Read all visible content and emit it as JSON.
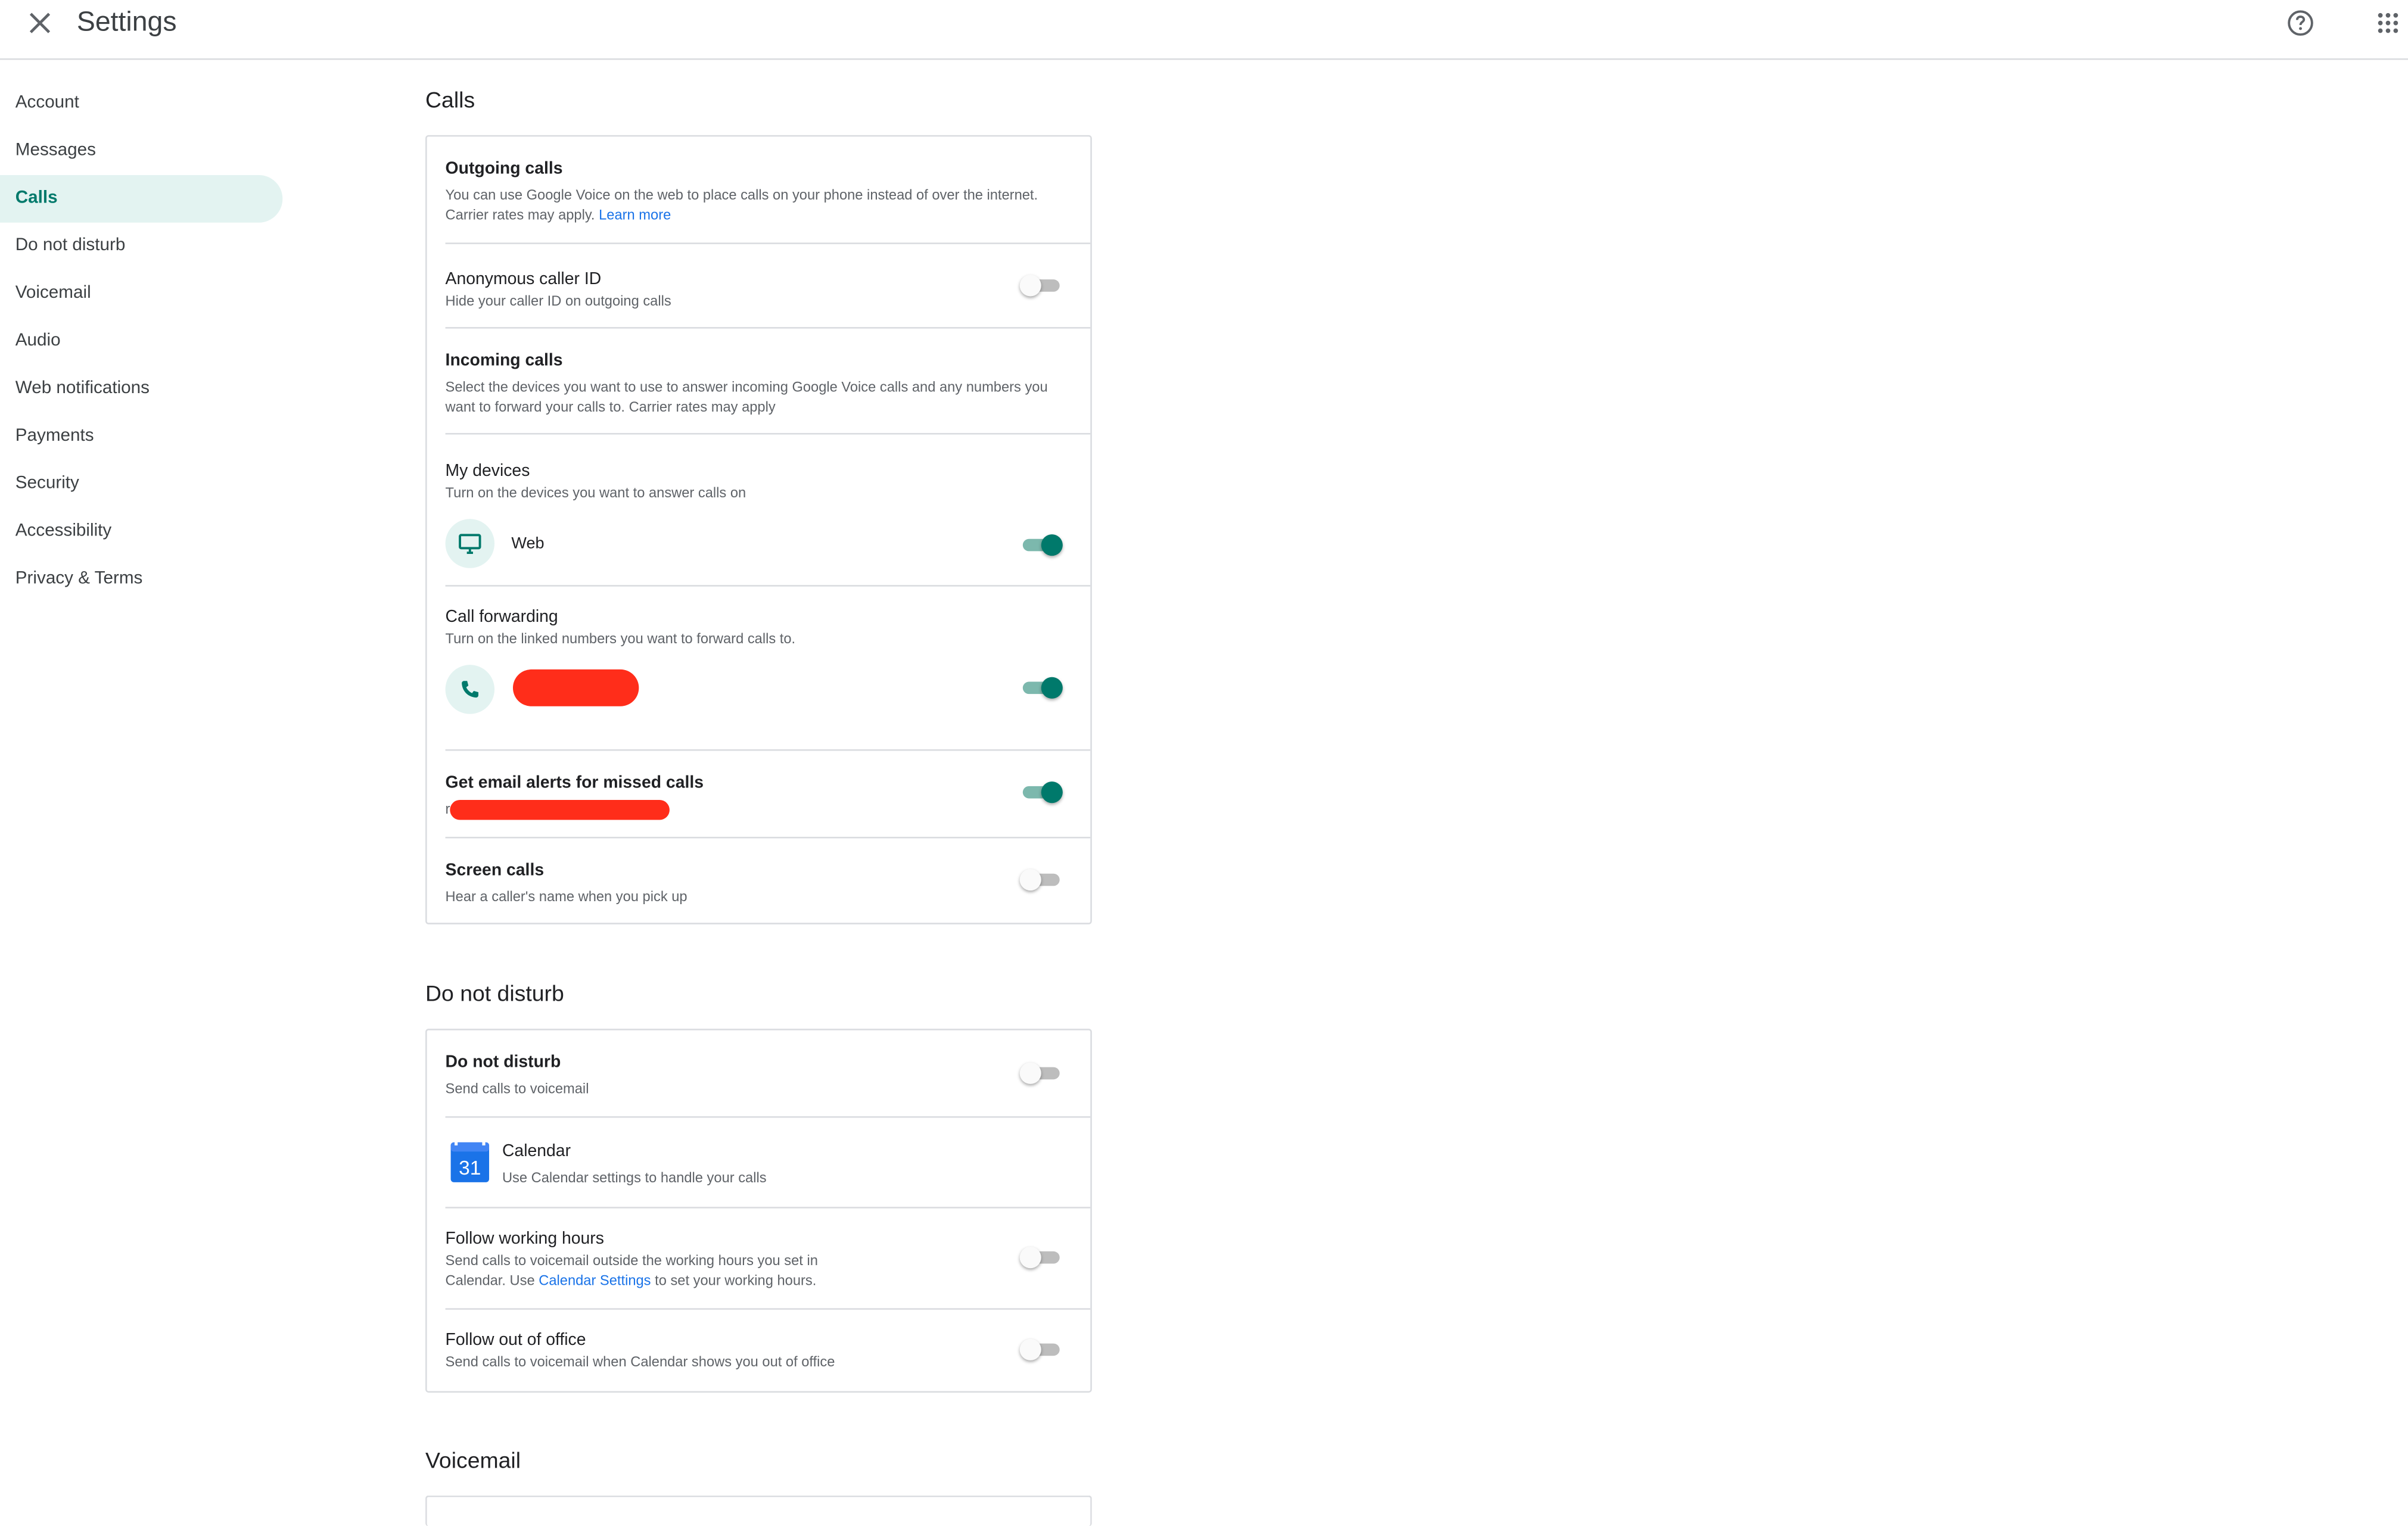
{
  "header": {
    "title": "Settings"
  },
  "sidebar": {
    "items": [
      {
        "label": "Account",
        "active": false
      },
      {
        "label": "Messages",
        "active": false
      },
      {
        "label": "Calls",
        "active": true
      },
      {
        "label": "Do not disturb",
        "active": false
      },
      {
        "label": "Voicemail",
        "active": false
      },
      {
        "label": "Audio",
        "active": false
      },
      {
        "label": "Web notifications",
        "active": false
      },
      {
        "label": "Payments",
        "active": false
      },
      {
        "label": "Security",
        "active": false
      },
      {
        "label": "Accessibility",
        "active": false
      },
      {
        "label": "Privacy & Terms",
        "active": false
      }
    ]
  },
  "calls": {
    "section_title": "Calls",
    "outgoing": {
      "title": "Outgoing calls",
      "desc": "You can use Google Voice on the web to place calls on your phone instead of over the internet. Carrier rates may apply.",
      "link": "Learn more"
    },
    "anonymous": {
      "title": "Anonymous caller ID",
      "desc": "Hide your caller ID on outgoing calls",
      "enabled": false
    },
    "incoming": {
      "title": "Incoming calls",
      "desc": "Select the devices you want to use to answer incoming Google Voice calls and any numbers you want to forward your calls to. Carrier rates may apply"
    },
    "my_devices": {
      "title": "My devices",
      "desc": "Turn on the devices you want to answer calls on",
      "device_icon": "monitor-icon",
      "device_label": "Web",
      "enabled": true
    },
    "forwarding": {
      "title": "Call forwarding",
      "desc": "Turn on the linked numbers you want to forward calls to.",
      "icon": "phone-icon",
      "enabled": true
    },
    "email_alerts": {
      "title": "Get email alerts for missed calls",
      "prefix": "r",
      "enabled": true
    },
    "screen": {
      "title": "Screen calls",
      "desc": "Hear a caller's name when you pick up",
      "enabled": false
    }
  },
  "dnd": {
    "section_title": "Do not disturb",
    "main": {
      "title": "Do not disturb",
      "desc": "Send calls to voicemail",
      "enabled": false
    },
    "calendar": {
      "title": "Calendar",
      "desc": "Use Calendar settings to handle your calls",
      "day": "31"
    },
    "working_hours": {
      "title": "Follow working hours",
      "desc_before": "Send calls to voicemail outside the working hours you set in Calendar. Use ",
      "link": "Calendar Settings",
      "desc_after": " to set your working hours.",
      "enabled": false
    },
    "out_of_office": {
      "title": "Follow out of office",
      "desc": "Send calls to voicemail when Calendar shows you out of office",
      "enabled": false
    }
  },
  "voicemail": {
    "section_title": "Voicemail"
  },
  "colors": {
    "accent": "#00796b",
    "active_bg": "#e3f3f1",
    "link": "#1a73e8",
    "redaction": "#ff2d1a"
  }
}
